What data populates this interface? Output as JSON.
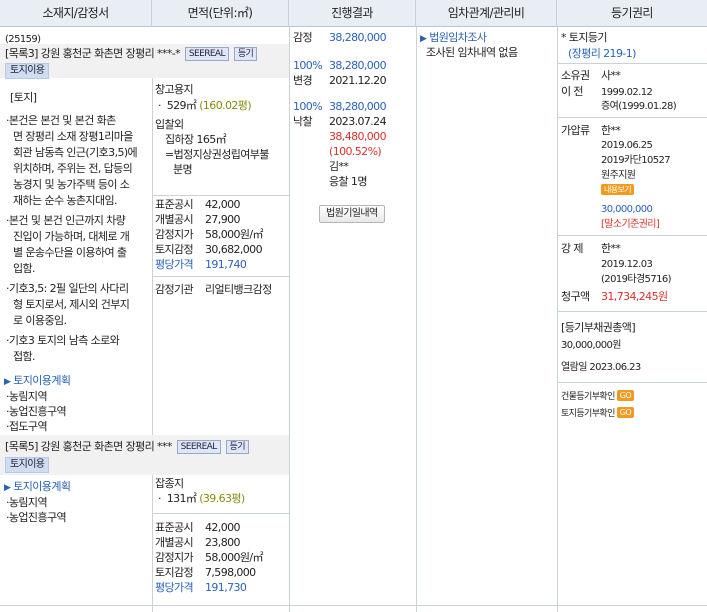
{
  "header": {
    "col1": "소재지/감정서",
    "col2": "면적(단위:㎡)",
    "col3": "진행결과",
    "col4": "임차관계/관리비",
    "col5": "등기권리"
  },
  "case": {
    "code": "(25159)"
  },
  "item3": {
    "title": "[목록3] 강원 홍천군 화촌면 장평리 ***-*",
    "seereal": "SEEREAL",
    "register": "등기",
    "land_use": "토지이용"
  },
  "land": {
    "heading": "[토지]",
    "bullets": [
      "·본건은 본건 및 본건 화촌",
      "면 장평리 소재 장평1리마을",
      "회관 남동측 인근(기호3,5)에",
      "위치하며, 주위는 전, 답등의",
      "농경지 및 농가주택 등이 소",
      "재하는 순수 농촌지대임.",
      "·본건 및 본건 인근까지 차량",
      "진입이 가능하며, 대체로 개",
      "별 운송수단을 이용하여 출",
      "입함.",
      "·기호3,5: 2필 일단의 사다리",
      "형 토지로서, 제시외 건부지",
      "로 이용중임.",
      "·기호3 토지의 남측 소로와",
      "접함."
    ],
    "plan_title": "토지이용계획",
    "plan_items": [
      "·농림지역",
      "·농업진흥구역",
      "·접도구역"
    ]
  },
  "area3": {
    "type": "창고용지",
    "size": "529㎡",
    "pyeong": "(160.02평)",
    "note": [
      "입찰외",
      "집하장 165㎡",
      "=법정지상권성립여부불",
      "분명"
    ],
    "price_labels": [
      "표준공시",
      "개별공시",
      "감정지가",
      "토지감정"
    ],
    "price_values": [
      "42,000",
      "27,900",
      "58,000원/㎡",
      "30,682,000"
    ],
    "avg_label": "평당가격",
    "avg_value": "191,740",
    "appraiser_label": "감정기관",
    "appraiser_value": "리얼티뱅크감정"
  },
  "progress": {
    "rows": [
      {
        "pct": "",
        "label": "감정",
        "value": "38,280,000"
      },
      {
        "pct": "100%",
        "label": "",
        "value": "38,280,000"
      },
      {
        "pct": "",
        "label": "변경",
        "value": "2021.12.20"
      },
      {
        "pct": "100%",
        "label": "",
        "value": "38,280,000"
      },
      {
        "pct": "",
        "label": "낙찰",
        "value": "2023.07.24"
      }
    ],
    "win_price": "38,480,000",
    "win_pct": "(100.52%)",
    "winner": "김**",
    "bidders": "응찰 1명",
    "court_button": "법원기일내역"
  },
  "lease": {
    "title": "법원임차조사",
    "text": "조사된 임차내역 없음"
  },
  "registry": {
    "land_title": "* 토지등기",
    "land_link": "(장평리 219-1)",
    "owner_label": "소유권",
    "owner_name": "사**",
    "transfer_label": "이 전",
    "transfer_date": "1999.02.12",
    "transfer_note": "증여(1999.01.28)",
    "seizure_label": "가압류",
    "seizure_name": "한**",
    "seizure_date": "2019.06.25",
    "seizure_case": "2019카단10527",
    "seizure_court": "원주지원",
    "seizure_btn": "내용보기",
    "seizure_amount": "30,000,000",
    "seizure_note": "[말소기준권리]",
    "forced_label": "강 제",
    "forced_name": "한**",
    "forced_date": "2019.12.03",
    "forced_case": "(2019타경5716)",
    "claim_label": "청구액",
    "claim_amount": "31,734,245원",
    "debt_title": "[등기부채권총액]",
    "debt_amount": "30,000,000원",
    "view_date": "열람일 2023.06.23",
    "bldg_check": "건물등기부확인",
    "land_check": "토지등기부확인",
    "go": "GO"
  },
  "item5": {
    "title": "[목록5] 강원 홍천군 화촌면 장평리 ***",
    "seereal": "SEEREAL",
    "register": "등기",
    "land_use": "토지이용",
    "plan_title": "토지이용계획",
    "plan_items": [
      "·농림지역",
      "·농업진흥구역"
    ]
  },
  "area5": {
    "type": "잡종지",
    "size": "131㎡",
    "pyeong": "(39.63평)",
    "price_labels": [
      "표준공시",
      "개별공시",
      "감정지가",
      "토지감정"
    ],
    "price_values": [
      "42,000",
      "23,800",
      "58,000원/㎡",
      "7,598,000"
    ],
    "avg_label": "평당가격",
    "avg_value": "191,730"
  }
}
